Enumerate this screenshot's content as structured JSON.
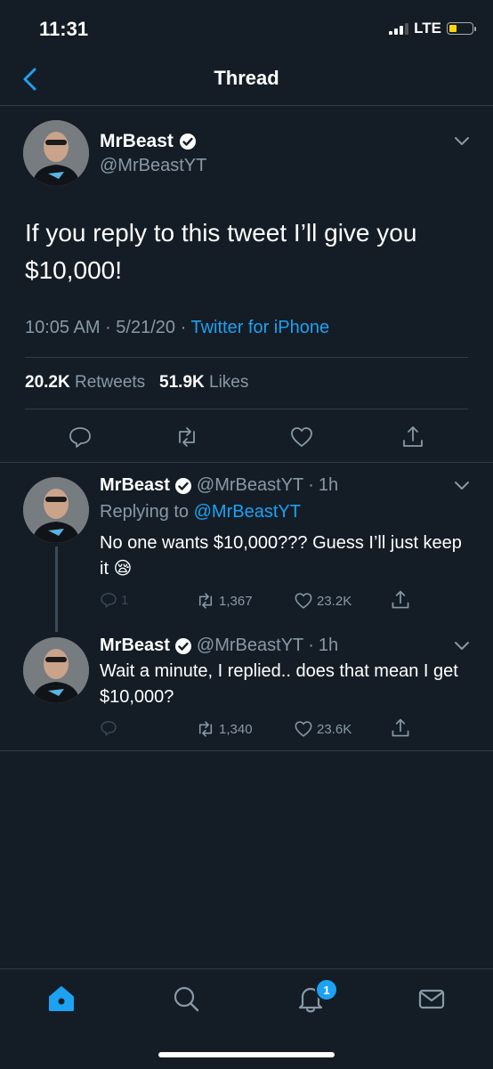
{
  "status_bar": {
    "time": "11:31",
    "network": "LTE",
    "battery_level": 0.35,
    "signal_bars_active": 3,
    "signal_bars_total": 4
  },
  "nav": {
    "title": "Thread"
  },
  "main_tweet": {
    "author_name": "MrBeast",
    "handle": "@MrBeastYT",
    "text": "If you reply to this tweet I’ll give you $10,000!",
    "time": "10:05 AM",
    "date": "5/21/20",
    "source": "Twitter for iPhone",
    "retweets_count": "20.2K",
    "retweets_label": "Retweets",
    "likes_count": "51.9K",
    "likes_label": "Likes"
  },
  "replies": [
    {
      "author_name": "MrBeast",
      "handle": "@MrBeastYT",
      "age": "1h",
      "replying_to_label": "Replying to",
      "replying_to_handle": "@MrBeastYT",
      "text": "No one wants $10,000??? Guess I’ll just keep it 😪",
      "reply_count": "1",
      "retweet_count": "1,367",
      "like_count": "23.2K"
    },
    {
      "author_name": "MrBeast",
      "handle": "@MrBeastYT",
      "age": "1h",
      "text": "Wait a minute, I replied.. does that mean I get $10,000?",
      "reply_count": "",
      "retweet_count": "1,340",
      "like_count": "23.6K"
    }
  ],
  "tab_bar": {
    "notifications_badge": "1"
  },
  "colors": {
    "background": "#141d26",
    "accent": "#1da1f2",
    "muted": "#8899a6",
    "divider": "#2f3b47"
  },
  "icons": {
    "back": "chevron-left-icon",
    "verified": "verified-badge-icon",
    "more": "chevron-down-icon",
    "reply": "reply-icon",
    "retweet": "retweet-icon",
    "like": "heart-icon",
    "share": "share-icon",
    "home": "home-icon",
    "search": "search-icon",
    "notifications": "bell-icon",
    "messages": "mail-icon"
  }
}
